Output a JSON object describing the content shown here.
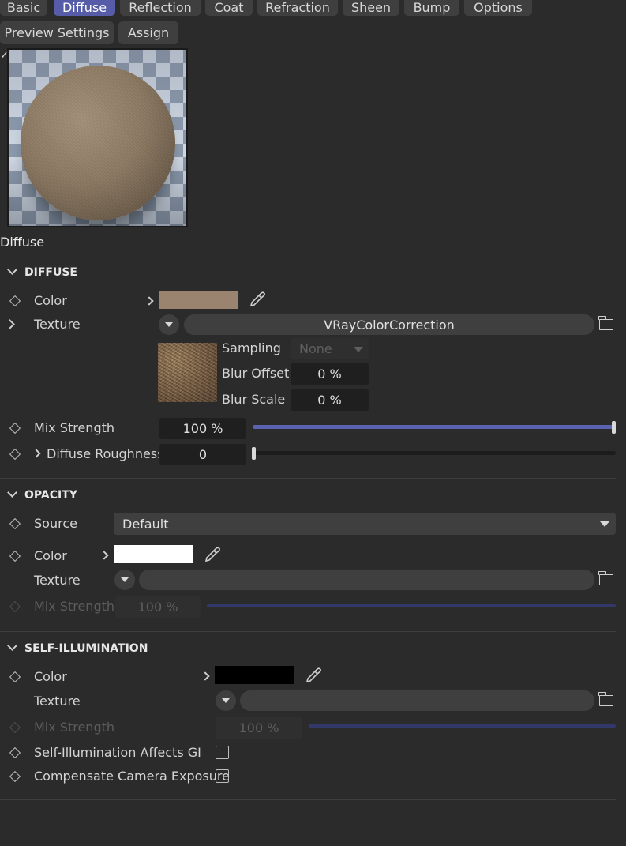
{
  "tabs": [
    {
      "label": "Basic",
      "active": false
    },
    {
      "label": "Diffuse",
      "active": true
    },
    {
      "label": "Reflection",
      "active": false
    },
    {
      "label": "Coat",
      "active": false
    },
    {
      "label": "Refraction",
      "active": false
    },
    {
      "label": "Sheen",
      "active": false
    },
    {
      "label": "Bump",
      "active": false
    },
    {
      "label": "Options",
      "active": false
    }
  ],
  "toolbar": {
    "preview_settings_label": "Preview Settings",
    "assign_label": "Assign"
  },
  "preview": {
    "caption": "Diffuse",
    "checkmark": "✓"
  },
  "diffuse": {
    "section_title": "DIFFUSE",
    "color_label": "Color",
    "color_value": "#9a8470",
    "texture_label": "Texture",
    "texture_value": "VRayColorCorrection",
    "sampling_label": "Sampling",
    "sampling_value": "None",
    "blur_offset_label": "Blur Offset",
    "blur_offset_value": "0 %",
    "blur_scale_label": "Blur Scale",
    "blur_scale_value": "0 %",
    "mix_strength_label": "Mix Strength",
    "mix_strength_value": "100 %",
    "mix_strength_fraction": 1.0,
    "roughness_label": "Diffuse Roughness",
    "roughness_value": "0",
    "roughness_fraction": 0.0
  },
  "opacity": {
    "section_title": "OPACITY",
    "source_label": "Source",
    "source_value": "Default",
    "color_label": "Color",
    "color_value": "#ffffff",
    "texture_label": "Texture",
    "mix_strength_label": "Mix Strength",
    "mix_strength_value": "100 %",
    "mix_strength_fraction": 1.0
  },
  "self_illumination": {
    "section_title": "SELF-ILLUMINATION",
    "color_label": "Color",
    "color_value": "#000000",
    "texture_label": "Texture",
    "mix_strength_label": "Mix Strength",
    "mix_strength_value": "100 %",
    "mix_strength_fraction": 1.0,
    "affects_gi_label": "Self-Illumination Affects GI",
    "affects_gi_checked": false,
    "compensate_label": "Compensate Camera Exposure",
    "compensate_checked": false
  },
  "colors": {
    "accent": "#565ca7",
    "slider_fill": "#5a63b0",
    "slider_dim": "#33386a",
    "background": "#2b2b2b"
  }
}
